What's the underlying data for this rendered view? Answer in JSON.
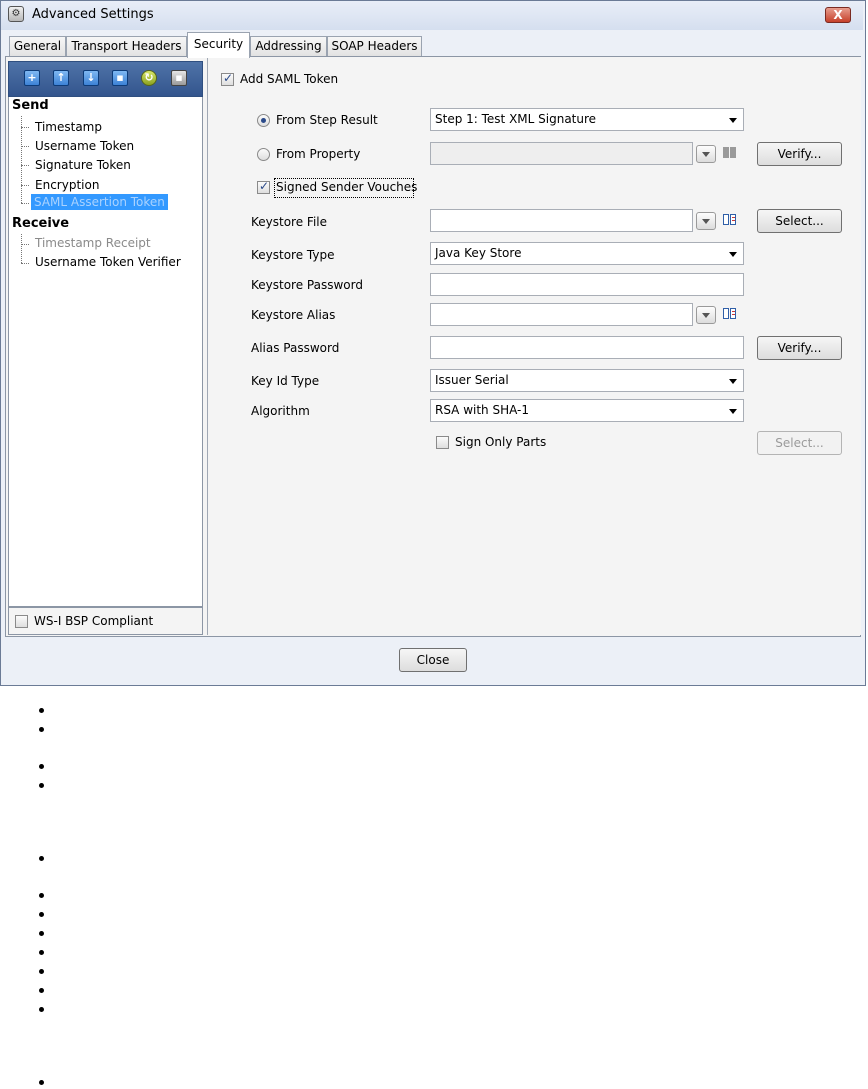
{
  "window": {
    "title": "Advanced Settings",
    "close_glyph": "X"
  },
  "tabs": [
    {
      "label": "General",
      "active": false
    },
    {
      "label": "Transport Headers",
      "active": false
    },
    {
      "label": "Security",
      "active": true
    },
    {
      "label": "Addressing",
      "active": false
    },
    {
      "label": "SOAP Headers",
      "active": false
    }
  ],
  "toolbar": {
    "icons": [
      "add-icon",
      "move-up-icon",
      "move-down-icon",
      "delete-icon",
      "refresh-icon",
      "save-icon"
    ],
    "glyphs": [
      "+",
      "↑",
      "↓",
      "▪",
      "↻",
      "▪"
    ]
  },
  "tree": {
    "send": {
      "label": "Send",
      "items": [
        "Timestamp",
        "Username Token",
        "Signature Token",
        "Encryption",
        "SAML Assertion Token"
      ]
    },
    "receive": {
      "label": "Receive",
      "items": [
        "Timestamp Receipt",
        "Username Token Verifier"
      ]
    },
    "selected": "SAML Assertion Token"
  },
  "bsp": {
    "label": "WS-I BSP Compliant",
    "checked": false
  },
  "form": {
    "add_saml": {
      "label": "Add SAML Token",
      "checked": true
    },
    "from_step_result": {
      "label": "From Step Result",
      "selected": true,
      "value": "Step 1: Test XML Signature"
    },
    "from_property": {
      "label": "From Property",
      "selected": false,
      "value": "",
      "verify_label": "Verify..."
    },
    "signed_sender": {
      "label": "Signed Sender Vouches",
      "checked": true
    },
    "keystore_file": {
      "label": "Keystore File",
      "value": "",
      "button": "Select..."
    },
    "keystore_type": {
      "label": "Keystore Type",
      "value": "Java Key Store"
    },
    "keystore_password": {
      "label": "Keystore Password",
      "value": ""
    },
    "keystore_alias": {
      "label": "Keystore Alias",
      "value": ""
    },
    "alias_password": {
      "label": "Alias Password",
      "value": "",
      "button": "Verify..."
    },
    "key_id_type": {
      "label": "Key Id Type",
      "value": "Issuer Serial"
    },
    "algorithm": {
      "label": "Algorithm",
      "value": "RSA with SHA-1"
    },
    "sign_only_parts": {
      "label": "Sign Only Parts",
      "checked": false,
      "button": "Select..."
    }
  },
  "footer": {
    "close_label": "Close"
  },
  "bullet_count": 15,
  "colors": {
    "selection": "#3399ff",
    "toolbar": "#3c5f96",
    "frame": "#ecf0f7"
  }
}
